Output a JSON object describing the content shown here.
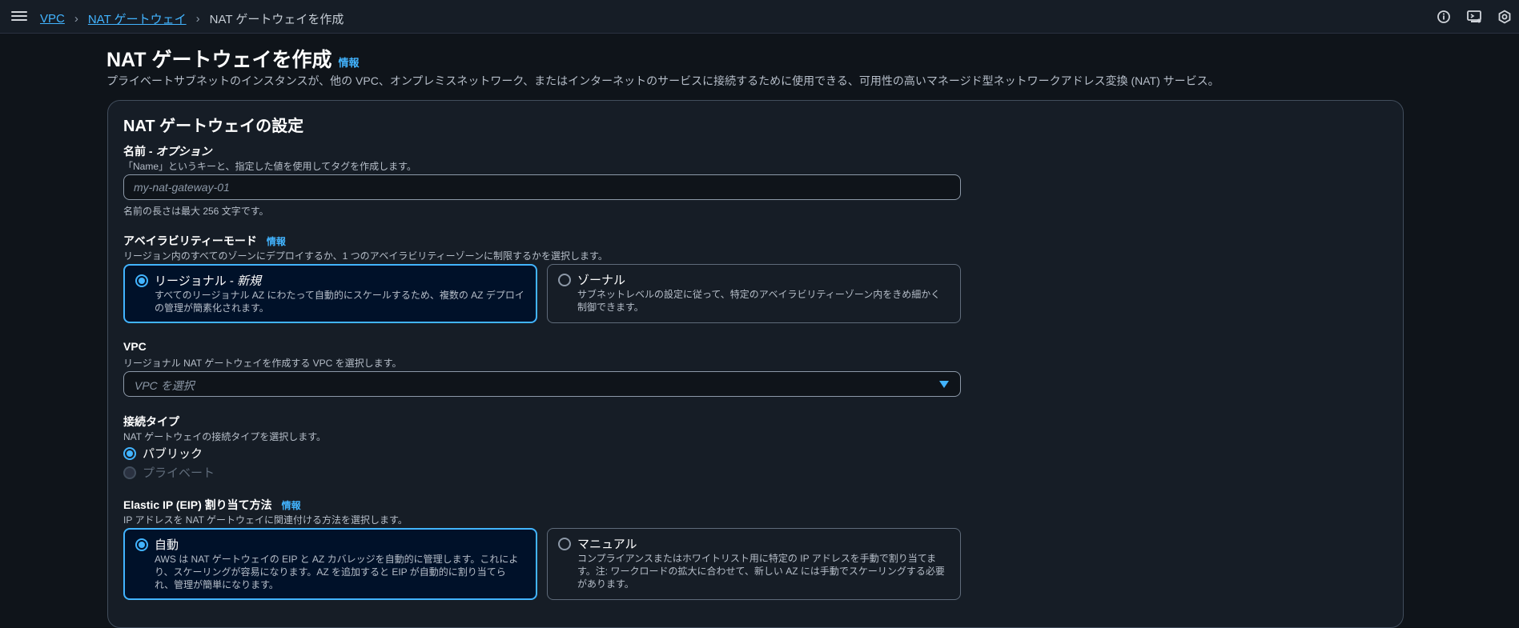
{
  "breadcrumb": {
    "items": [
      "VPC",
      "NAT ゲートウェイ"
    ],
    "current": "NAT ゲートウェイを作成"
  },
  "header_icons": [
    "info-circle-icon",
    "cloudshell-icon",
    "settings-hex-icon"
  ],
  "page": {
    "title": "NAT ゲートウェイを作成",
    "info": "情報",
    "description": "プライベートサブネットのインスタンスが、他の VPC、オンプレミスネットワーク、またはインターネットのサービスに接続するために使用できる、可用性の高いマネージド型ネットワークアドレス変換 (NAT) サービス。"
  },
  "card": {
    "title": "NAT ゲートウェイの設定",
    "name": {
      "label": "名前 - ",
      "label_optional": "オプション",
      "description": "「Name」というキーと、指定した値を使用してタグを作成します。",
      "placeholder": "my-nat-gateway-01",
      "constraint": "名前の長さは最大 256 文字です。"
    },
    "availability": {
      "label": "アベイラビリティーモード",
      "info": "情報",
      "description": "リージョン内のすべてのゾーンにデプロイするか、1 つのアベイラビリティーゾーンに制限するかを選択します。",
      "regional_title": "リージョナル - ",
      "regional_new": "新規",
      "regional_desc": "すべてのリージョナル AZ にわたって自動的にスケールするため、複数の AZ デプロイの管理が簡素化されます。",
      "zonal_title": "ゾーナル",
      "zonal_desc": "サブネットレベルの設定に従って、特定のアベイラビリティーゾーン内をきめ細かく制御できます。",
      "selected": "regional"
    },
    "vpc": {
      "label": "VPC",
      "description": "リージョナル NAT ゲートウェイを作成する VPC を選択します。",
      "placeholder": "VPC を選択"
    },
    "connectivity": {
      "label": "接続タイプ",
      "description": "NAT ゲートウェイの接続タイプを選択します。",
      "public": "パブリック",
      "private": "プライベート",
      "selected": "public"
    },
    "eip": {
      "label": "Elastic IP (EIP) 割り当て方法",
      "info": "情報",
      "description": "IP アドレスを NAT ゲートウェイに関連付ける方法を選択します。",
      "auto_title": "自動",
      "auto_desc": "AWS は NAT ゲートウェイの EIP と AZ カバレッジを自動的に管理します。これにより、スケーリングが容易になります。AZ を追加すると EIP が自動的に割り当てられ、管理が簡単になります。",
      "manual_title": "マニュアル",
      "manual_desc": "コンプライアンスまたはホワイトリスト用に特定の IP アドレスを手動で割り当てます。注: ワークロードの拡大に合わせて、新しい AZ には手動でスケーリングする必要があります。",
      "selected": "auto"
    }
  },
  "colors": {
    "background": "#0f141a",
    "panel": "#161d26",
    "accent": "#42b4ff",
    "selected_tile": "#001129",
    "border": "#414d5c"
  }
}
